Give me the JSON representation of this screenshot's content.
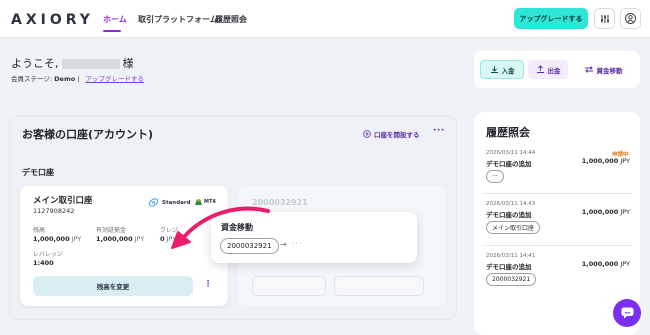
{
  "brand": "AXIORY",
  "nav": {
    "home": "ホーム",
    "platform": "取引プラットフォーム",
    "history": "履歴照会"
  },
  "header": {
    "upgrade_label": "アップグレードする"
  },
  "welcome": {
    "greeting": "ようこそ,",
    "honorific": "様",
    "stage_label": "会員ステージ:",
    "stage_value": "Demo",
    "stage_link": "アップグレードする"
  },
  "actions": {
    "deposit": "入金",
    "withdraw": "出金",
    "transfer": "資金移動"
  },
  "accounts_section": {
    "title": "お客様の口座(アカウント)",
    "open_account": "口座を開設する",
    "demo_heading": "デモ口座",
    "card": {
      "name": "メイン取引口座",
      "number": "1127908242",
      "type": "Standard",
      "platform": "MT4",
      "balance_label": "残高",
      "balance_value": "1,000,000",
      "equity_label": "有効証拠金",
      "equity_value": "1,000,000",
      "credit_label": "クレジ",
      "credit_value": "0",
      "currency": "JPY",
      "leverage_label": "レバレッジ",
      "leverage_value": "1:400",
      "change_balance": "残高を変更"
    },
    "ghost_card": {
      "number": "2000032921"
    }
  },
  "transfer_popup": {
    "title": "資金移動",
    "account_chip": "2000032921",
    "arrow": "→",
    "dots": "···"
  },
  "history": {
    "title": "履歴照会",
    "items": [
      {
        "date": "2026/03/11 14:44",
        "text": "デモ口座の追加",
        "status": "申請中",
        "amount": "1,000,000",
        "currency": "JPY",
        "chip": "···"
      },
      {
        "date": "2026/03/11 14:43",
        "text": "デモ口座の追加",
        "status": "",
        "amount": "1,000,000",
        "currency": "JPY",
        "chip": "メイン取引口座"
      },
      {
        "date": "2026/03/11 14:41",
        "text": "デモ口座の追加",
        "status": "",
        "amount": "1,000,000",
        "currency": "JPY",
        "chip": "2000032921"
      }
    ]
  },
  "colors": {
    "accent": "#8a2be2",
    "teal": "#2ee6d6",
    "pink_arrow": "#ec1c6a",
    "chat": "#7b2ff0"
  },
  "icons": [
    "sliders-icon",
    "user-icon",
    "deposit-icon",
    "withdraw-icon",
    "transfer-icon",
    "plus-circle-icon",
    "chat-icon"
  ]
}
